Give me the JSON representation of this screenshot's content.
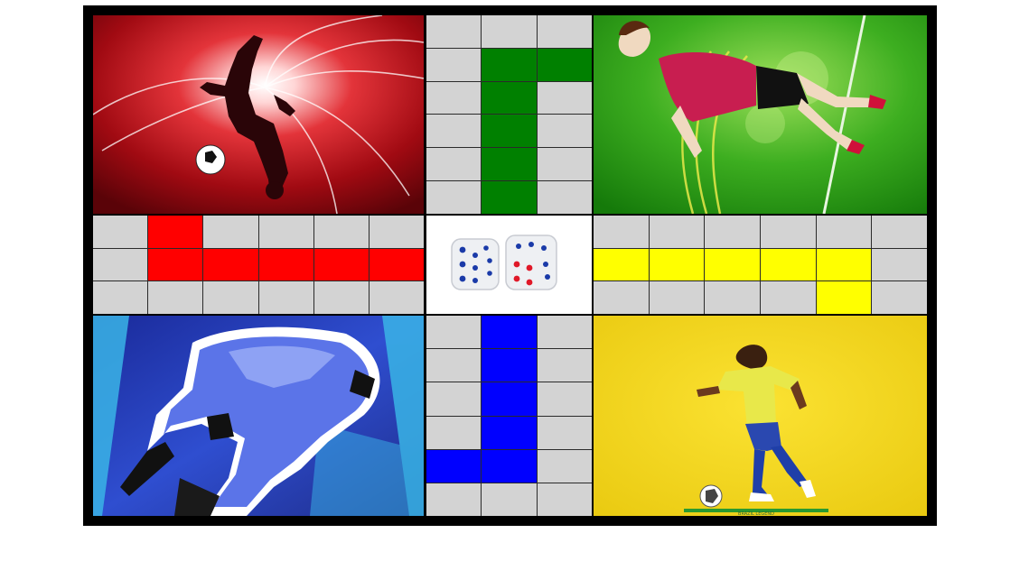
{
  "board": {
    "colors": {
      "empty": "#d3d3d3",
      "red": "#ff0000",
      "green": "#008000",
      "yellow": "#ffff00",
      "blue": "#0000ff",
      "border": "#000000"
    },
    "cells": {
      "top": [
        "e",
        "e",
        "e",
        "e",
        "g",
        "g",
        "e",
        "g",
        "e",
        "e",
        "g",
        "e",
        "e",
        "g",
        "e",
        "e",
        "g",
        "e"
      ],
      "left": [
        "e",
        "r",
        "e",
        "e",
        "e",
        "e",
        "e",
        "r",
        "r",
        "r",
        "r",
        "r",
        "e",
        "e",
        "e",
        "e",
        "e",
        "e"
      ],
      "right": [
        "e",
        "e",
        "e",
        "e",
        "e",
        "e",
        "y",
        "y",
        "y",
        "y",
        "y",
        "e",
        "e",
        "e",
        "e",
        "e",
        "y",
        "e"
      ],
      "bottom": [
        "e",
        "b",
        "e",
        "e",
        "b",
        "e",
        "e",
        "b",
        "e",
        "e",
        "b",
        "e",
        "b",
        "b",
        "e",
        "e",
        "e",
        "e"
      ]
    },
    "quadrants": {
      "top_left": {
        "icon": "overhead-kick-silhouette-icon",
        "accent": "#c0101a"
      },
      "top_right": {
        "icon": "bicycle-kick-player-icon",
        "accent": "#33b31a"
      },
      "bottom_left": {
        "icon": "striker-comic-illustration-icon",
        "accent": "#3550d8"
      },
      "bottom_right": {
        "icon": "dribbling-player-icon",
        "accent": "#f2d21a",
        "caption": "BRAZIL LEGEND"
      }
    },
    "dice": {
      "left_face": 6,
      "right_face": 6,
      "icon": "dice-pair-icon"
    }
  }
}
